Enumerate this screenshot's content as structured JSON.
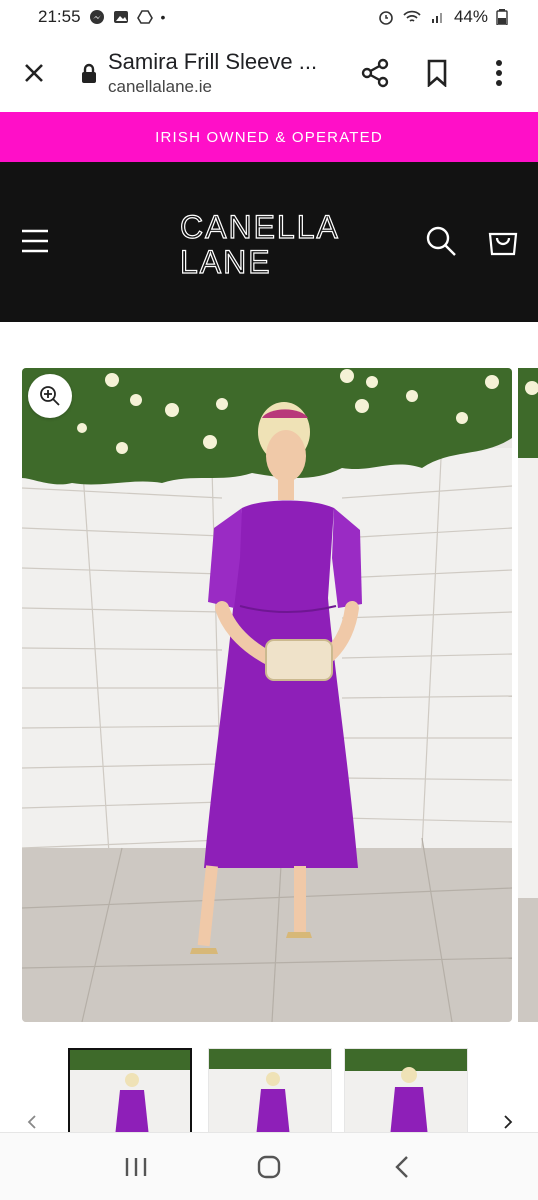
{
  "status_bar": {
    "time": "21:55",
    "battery": "44%"
  },
  "browser": {
    "title": "Samira Frill Sleeve ...",
    "url": "canellalane.ie"
  },
  "promo": {
    "text": "IRISH OWNED & OPERATED"
  },
  "header": {
    "logo_line1": "CANELLA",
    "logo_line2": "LANE"
  },
  "colors": {
    "promo_bg": "#ff0fc8",
    "header_bg": "#121212",
    "dress": "#8e1fb8"
  },
  "icons": [
    "messenger-icon",
    "gallery-icon",
    "drive-icon",
    "alarm-icon",
    "wifi-icon",
    "signal-icon",
    "battery-icon",
    "close-icon",
    "lock-icon",
    "share-icon",
    "bookmark-icon",
    "more-icon",
    "menu-icon",
    "search-icon",
    "bag-icon",
    "zoom-icon",
    "recents-icon",
    "home-icon",
    "back-icon"
  ]
}
